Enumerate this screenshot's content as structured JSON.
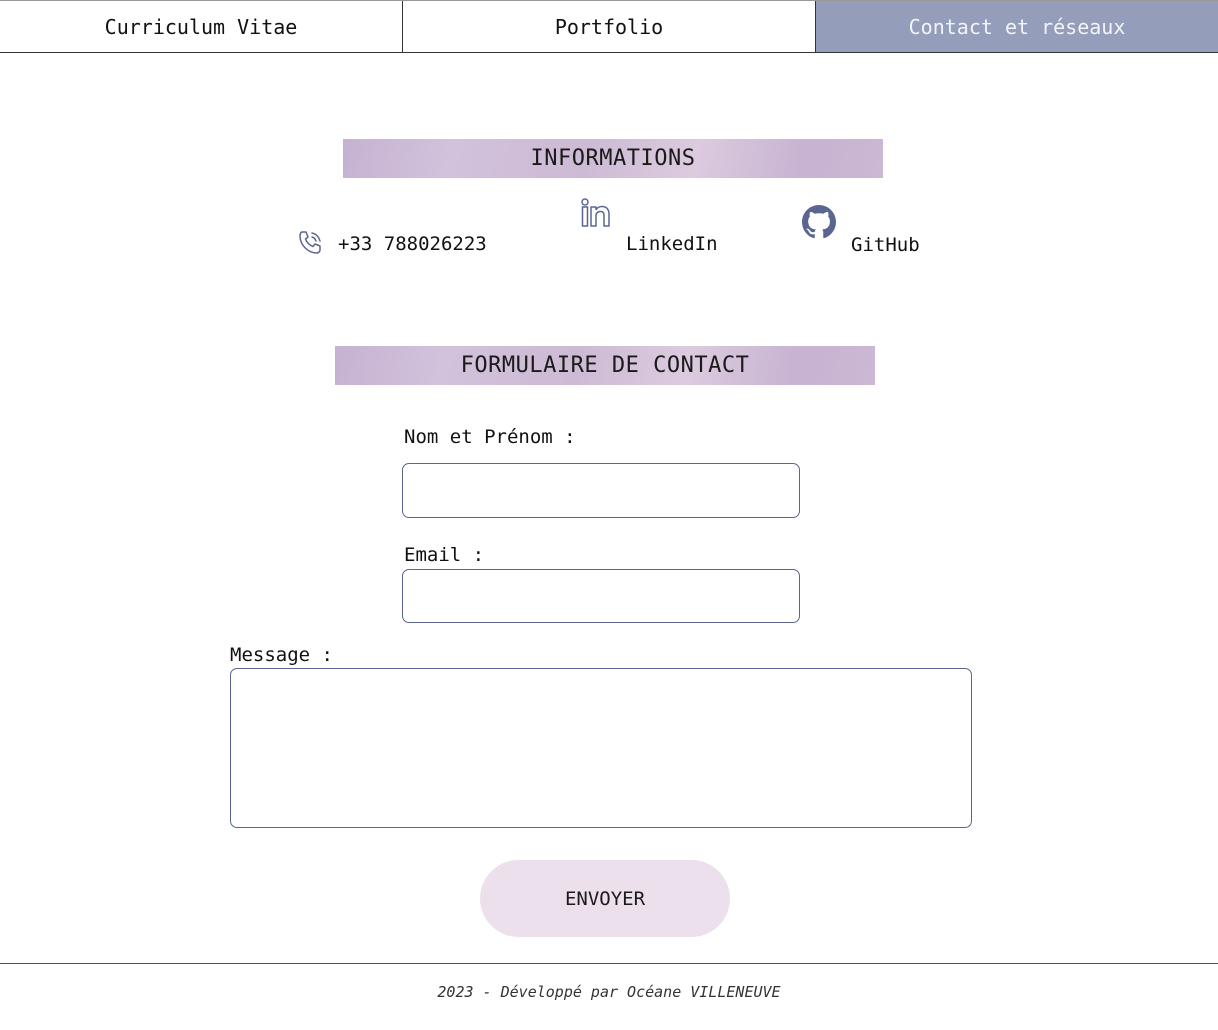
{
  "nav": {
    "tabs": [
      {
        "label": "Curriculum Vitae"
      },
      {
        "label": "Portfolio"
      },
      {
        "label": "Contact et réseaux"
      }
    ],
    "active_color": "#949db9"
  },
  "informations": {
    "title": "INFORMATIONS",
    "phone": "+33 788026223",
    "linkedin": "LinkedIn",
    "github": "GitHub",
    "icons": [
      "phone-icon",
      "linkedin-icon",
      "github-icon"
    ],
    "icon_color": "#5b6690"
  },
  "form": {
    "title": "FORMULAIRE DE CONTACT",
    "name_label": "Nom et Prénom :",
    "email_label": "Email :",
    "message_label": "Message :",
    "name_value": "",
    "email_value": "",
    "message_value": "",
    "submit_label": "ENVOYER"
  },
  "footer": {
    "text": "2023 - Développé par Océane VILLENEUVE"
  }
}
